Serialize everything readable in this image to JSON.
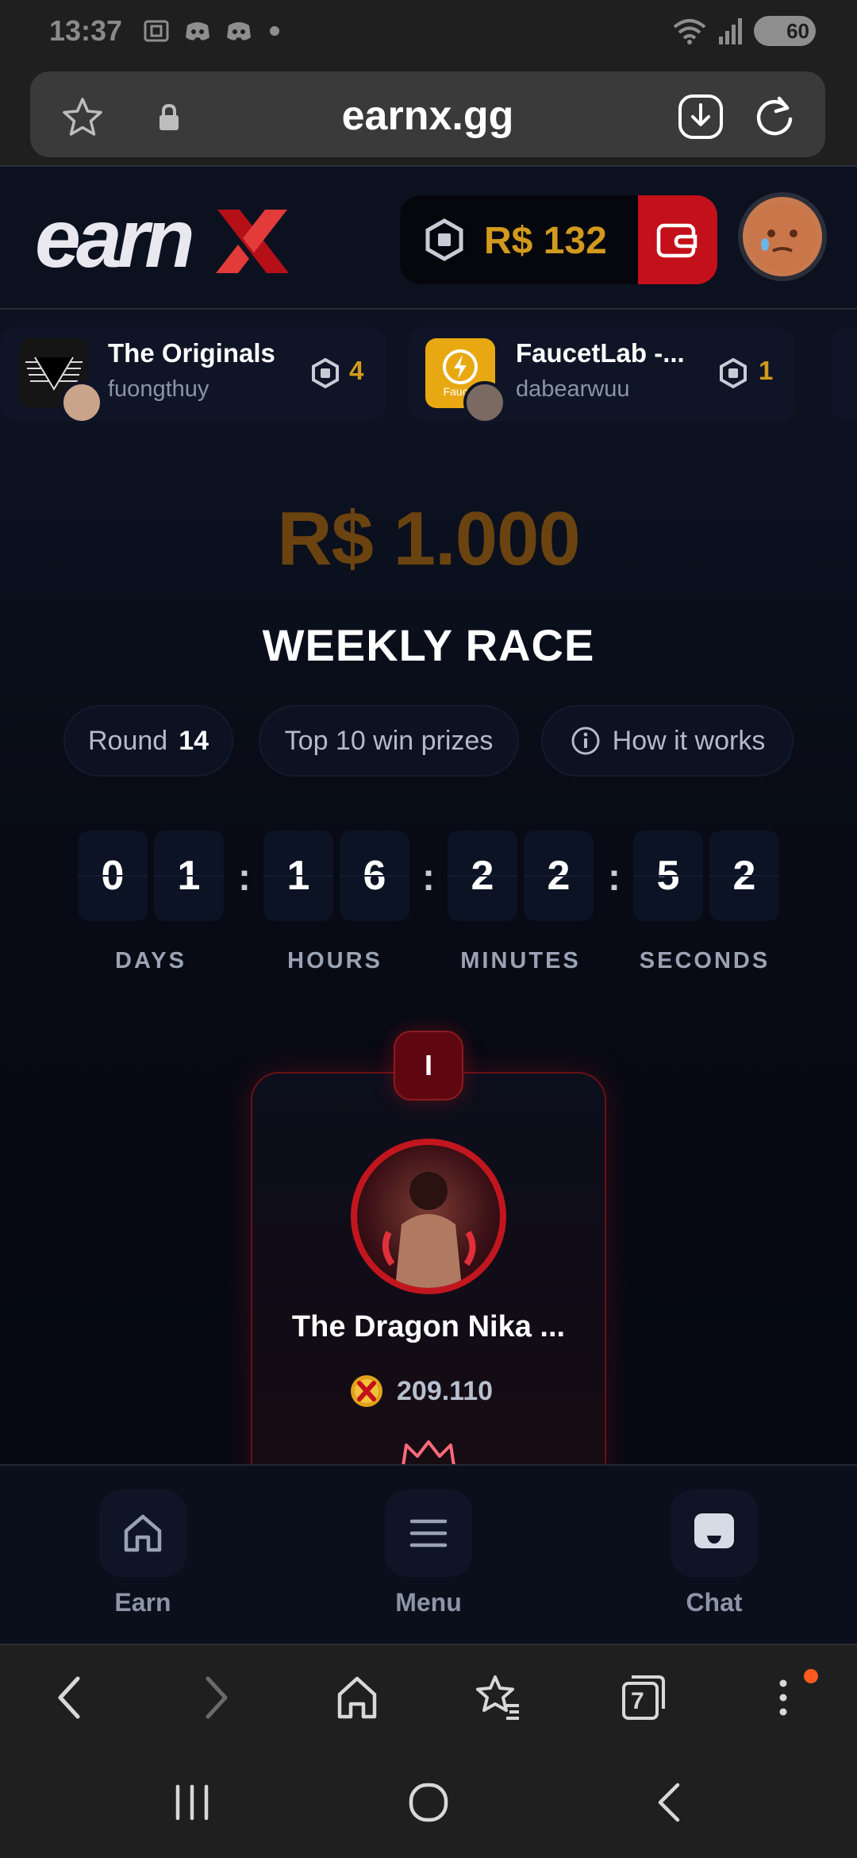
{
  "status_bar": {
    "time": "13:37",
    "battery": "60"
  },
  "browser": {
    "url": "earnx.gg",
    "tab_count": "7"
  },
  "header": {
    "logo": "earnX",
    "balance": "R$ 132"
  },
  "offers": [
    {
      "title": "The Originals",
      "user": "fuongthuy",
      "reward": "4"
    },
    {
      "title": "FaucetLab -...",
      "user": "dabearwuu",
      "reward": "1",
      "thumb_text": "Faucet"
    }
  ],
  "race": {
    "prize": "R$ 1.000",
    "title": "WEEKLY RACE",
    "round_label": "Round",
    "round_value": "14",
    "prizes_text": "Top 10 win prizes",
    "how_it_works": "How it works"
  },
  "countdown": {
    "digits": [
      "0",
      "1",
      "1",
      "6",
      "2",
      "2",
      "5",
      "2"
    ],
    "labels": [
      "DAYS",
      "HOURS",
      "MINUTES",
      "SECONDS"
    ],
    "separator": ":"
  },
  "leader": {
    "rank": "I",
    "name": "The Dragon Nika ...",
    "points": "209.110"
  },
  "bottom_nav": {
    "earn": "Earn",
    "menu": "Menu",
    "chat": "Chat"
  },
  "colors": {
    "accent_red": "#c4101a",
    "gold": "#d19a1d",
    "background": "#0b0e18"
  }
}
